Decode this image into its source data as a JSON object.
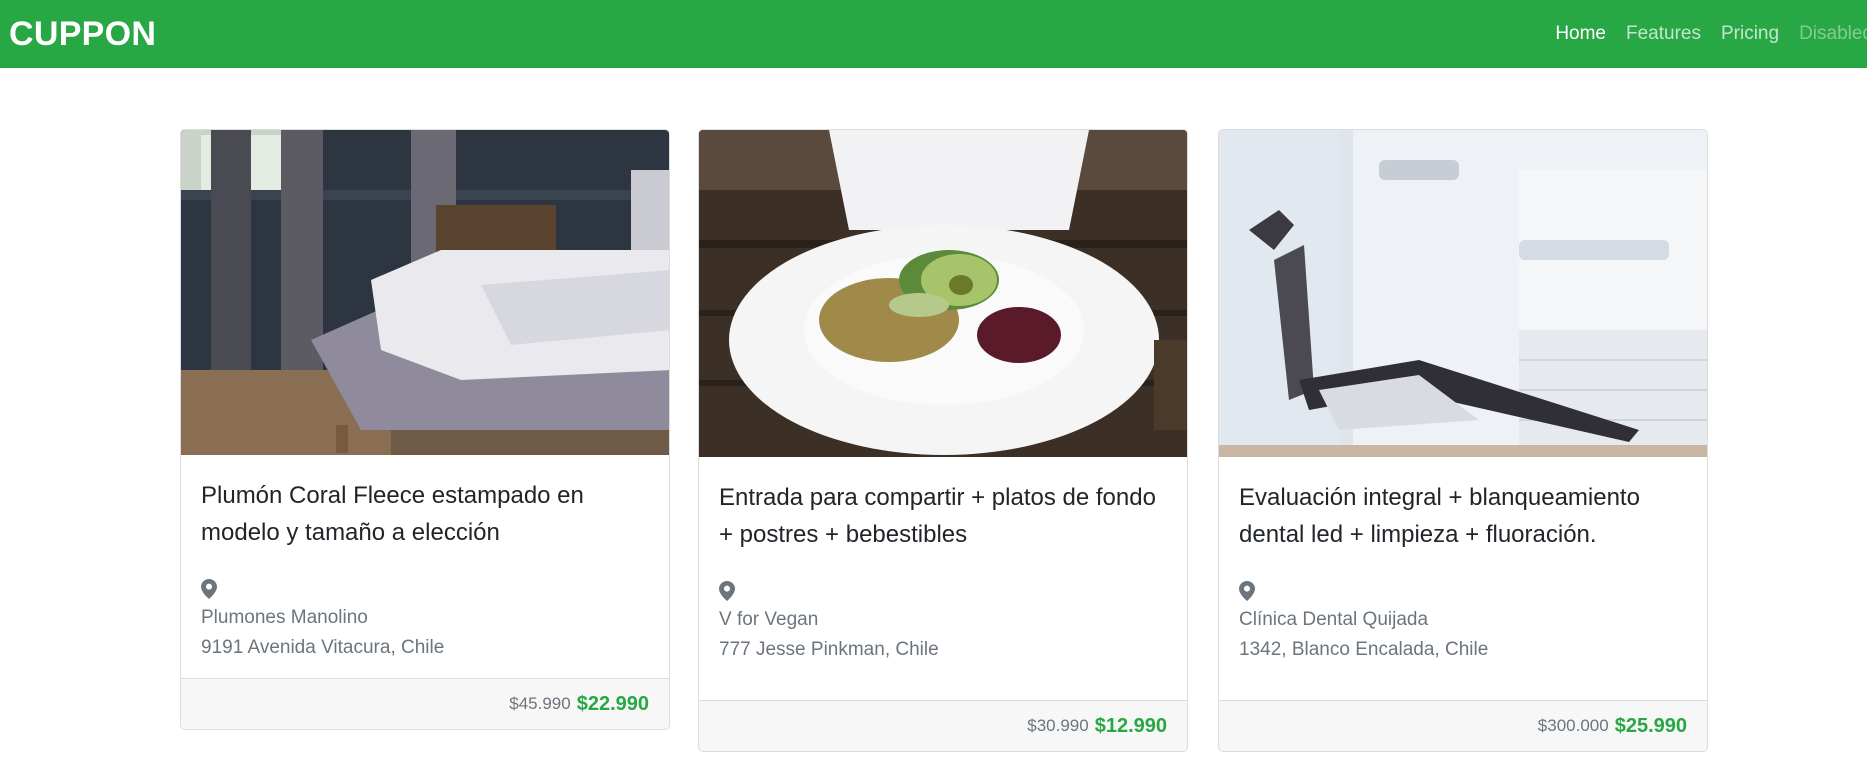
{
  "navbar": {
    "brand": "CUPPON",
    "links": [
      {
        "label": "Home",
        "state": "active"
      },
      {
        "label": "Features",
        "state": "normal"
      },
      {
        "label": "Pricing",
        "state": "normal"
      },
      {
        "label": "Disabled",
        "state": "disabled"
      }
    ]
  },
  "colors": {
    "brand_green": "#28a745",
    "muted_text": "#6c757d",
    "footer_bg": "#f7f7f7"
  },
  "deals": [
    {
      "image": "bedroom-bed-photo",
      "title": "Plumón Coral Fleece estampado en modelo y tamaño a elección",
      "location_icon": "map-pin-icon",
      "vendor": "Plumones Manolino",
      "address": "9191 Avenida Vitacura, Chile",
      "old_price": "$45.990",
      "new_price": "$22.990"
    },
    {
      "image": "salad-plate-photo",
      "title": "Entrada para compartir + platos de fondo + postres + bebestibles",
      "location_icon": "map-pin-icon",
      "vendor": "V for Vegan",
      "address": "777 Jesse Pinkman, Chile",
      "old_price": "$30.990",
      "new_price": "$12.990"
    },
    {
      "image": "dental-chair-photo",
      "title": "Evaluación integral + blanqueamiento dental led + limpieza + fluoración.",
      "location_icon": "map-pin-icon",
      "vendor": "Clínica Dental Quijada",
      "address": "1342, Blanco Encalada, Chile",
      "old_price": "$300.000",
      "new_price": "$25.990"
    }
  ]
}
